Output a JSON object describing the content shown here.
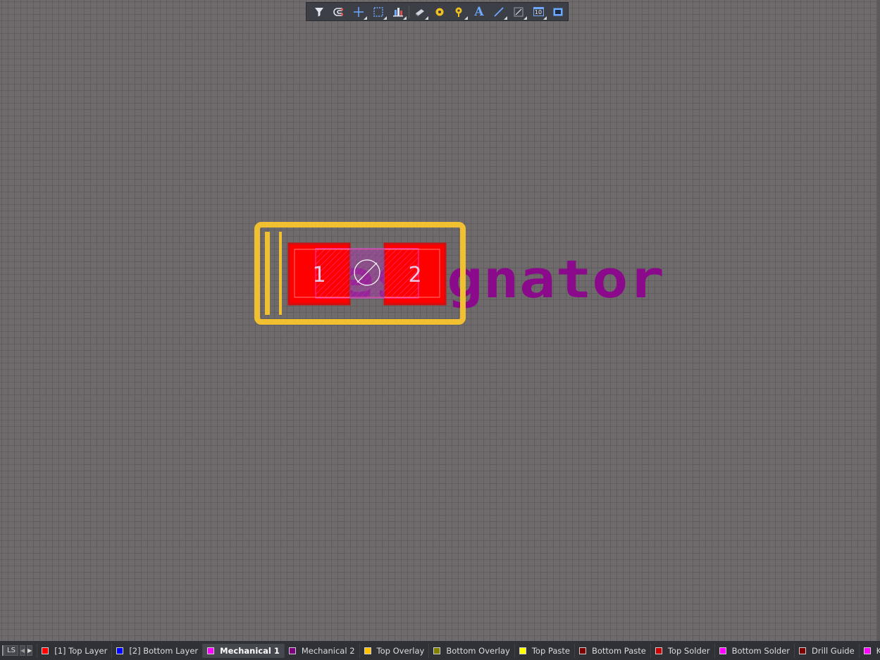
{
  "toolbar": {
    "tools": [
      {
        "name": "filter-icon",
        "dropdown": false
      },
      {
        "name": "snap-magnet-icon",
        "dropdown": false
      },
      {
        "name": "crosshair-icon",
        "dropdown": true
      },
      {
        "name": "selection-rectangle-icon",
        "dropdown": true
      },
      {
        "name": "align-icon",
        "dropdown": true
      },
      {
        "name": "component-body-icon",
        "dropdown": true
      },
      {
        "name": "pad-icon",
        "dropdown": false
      },
      {
        "name": "via-icon",
        "dropdown": true
      },
      {
        "name": "text-icon",
        "dropdown": false
      },
      {
        "name": "line-icon",
        "dropdown": true
      },
      {
        "name": "dimension-icon",
        "dropdown": true
      },
      {
        "name": "designator-icon",
        "dropdown": true
      },
      {
        "name": "region-icon",
        "dropdown": false
      }
    ],
    "text_glyph": "A",
    "designator_glyph": "10"
  },
  "footprint": {
    "pad1_label": "1",
    "pad2_label": "2",
    "designator_text": "Designator",
    "colors": {
      "top_layer": "#ff0000",
      "top_solder": "#cc1111",
      "overlay": "#f0c030",
      "mechanical": "#8b0a8b",
      "paste_outline": "#ff44ff"
    }
  },
  "statusbar": {
    "current_layer_color": "#ff00ff",
    "ls_label": "LS",
    "prev_arrow": "◀",
    "next_arrow": "▶",
    "layers": [
      {
        "label": "[1] Top Layer",
        "color": "#ff0000",
        "active": false
      },
      {
        "label": "[2] Bottom Layer",
        "color": "#0000ff",
        "active": false
      },
      {
        "label": "Mechanical 1",
        "color": "#ff00ff",
        "active": true
      },
      {
        "label": "Mechanical 2",
        "color": "#800080",
        "active": false
      },
      {
        "label": "Top Overlay",
        "color": "#ffc000",
        "active": false
      },
      {
        "label": "Bottom Overlay",
        "color": "#808000",
        "active": false
      },
      {
        "label": "Top Paste",
        "color": "#ffff00",
        "active": false
      },
      {
        "label": "Bottom Paste",
        "color": "#800000",
        "active": false
      },
      {
        "label": "Top Solder",
        "color": "#cc0000",
        "active": false
      },
      {
        "label": "Bottom Solder",
        "color": "#ff00ff",
        "active": false
      },
      {
        "label": "Drill Guide",
        "color": "#800000",
        "active": false
      },
      {
        "label": "Keep-Out Layer",
        "color": "#ff00ff",
        "active": false
      }
    ]
  }
}
